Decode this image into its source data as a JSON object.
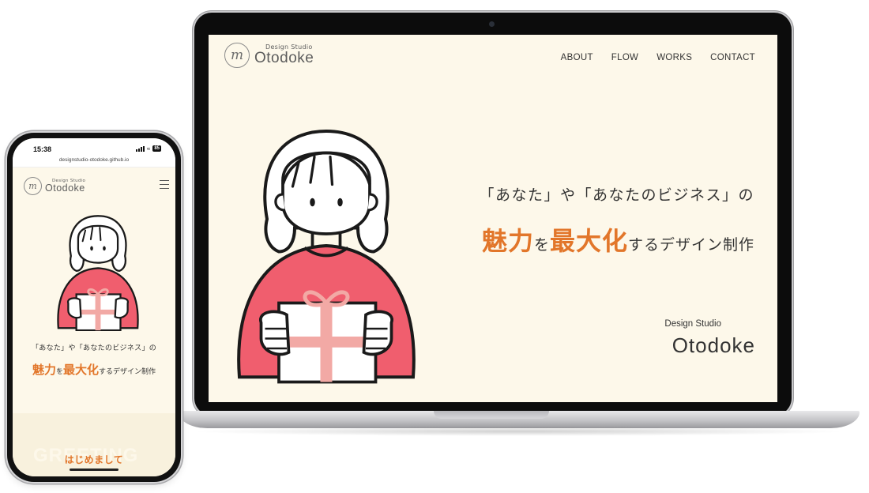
{
  "brand": {
    "logo_mark": "m",
    "subtitle": "Design Studio",
    "name": "Otodoke"
  },
  "nav": {
    "items": [
      "ABOUT",
      "FLOW",
      "WORKS",
      "CONTACT"
    ]
  },
  "hero": {
    "line1": "「あなた」や「あなたのビジネス」の",
    "accent_1": "魅力",
    "particle": "を",
    "accent_2": "最大化",
    "rest": "するデザイン制作",
    "studio_sub": "Design Studio",
    "studio_name": "Otodoke"
  },
  "phone": {
    "time": "15:38",
    "battery": "85",
    "url": "designstudio-otodoke.github.io",
    "menu_icon": "hamburger-icon",
    "greeting_bg": "GREETING",
    "greeting_title": "はじめまして"
  },
  "colors": {
    "accent": "#e2762a",
    "background": "#fdf8ea",
    "sweater": "#f05e6e",
    "ribbon": "#f2a9a5"
  }
}
